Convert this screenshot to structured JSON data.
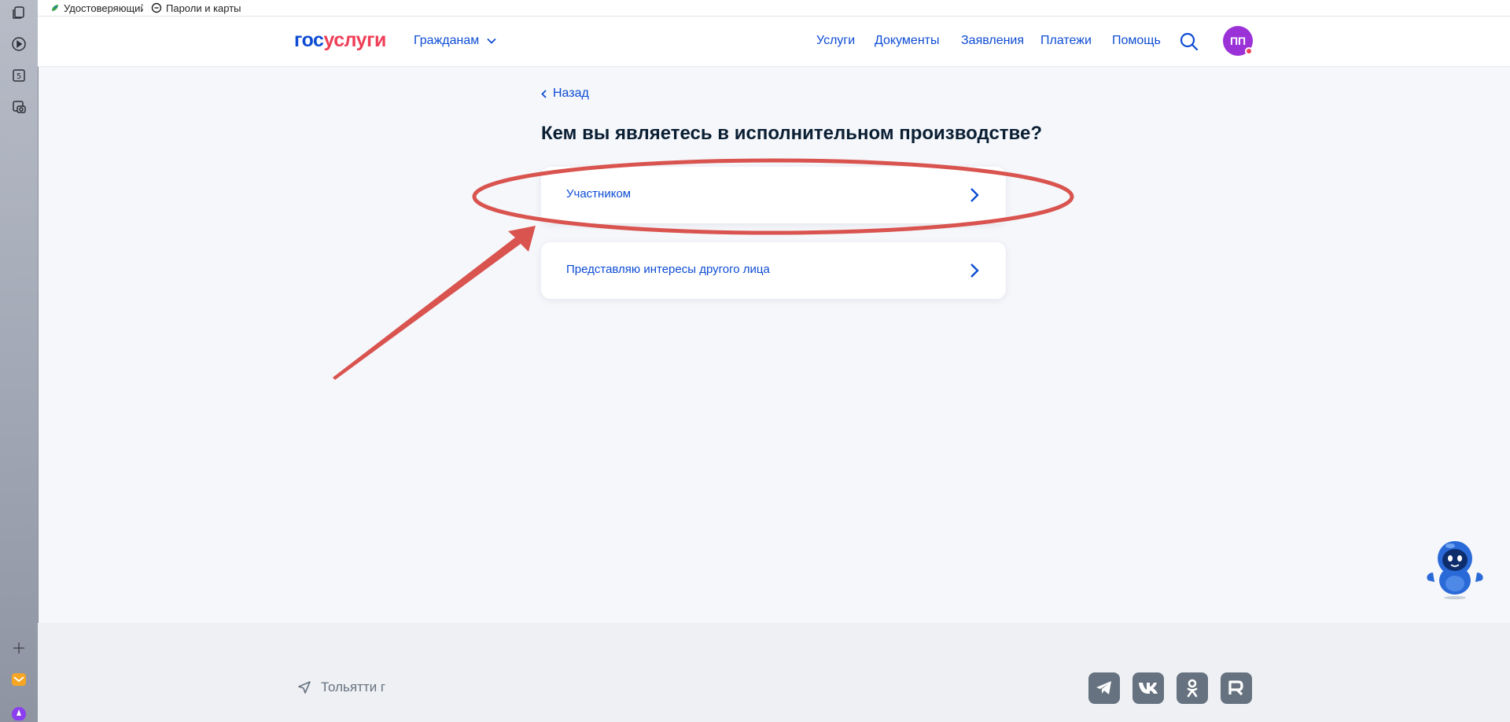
{
  "bookmarks": [
    {
      "label": "Удостоверяющий",
      "icon": "leaf-icon"
    },
    {
      "label": "Пароли и карты",
      "icon": "key-icon"
    }
  ],
  "header": {
    "logo": {
      "part1": "гос",
      "part2": "услуги"
    },
    "audience_menu": "Гражданам",
    "nav": [
      "Услуги",
      "Документы",
      "Заявления",
      "Платежи",
      "Помощь"
    ],
    "avatar_initials": "ПП"
  },
  "content": {
    "back_label": "Назад",
    "title": "Кем вы являетесь в исполнительном производстве?",
    "options": [
      "Участником",
      "Представляю интересы другого лица"
    ]
  },
  "footer": {
    "city": "Тольятти г",
    "social": [
      "telegram-icon",
      "vk-icon",
      "odnoklassniki-icon",
      "rutube-icon"
    ]
  },
  "colors": {
    "brand_blue": "#0d4cd3",
    "brand_red": "#ee3f58",
    "annotation": "#d9534f",
    "avatar": "#9b32d8"
  }
}
